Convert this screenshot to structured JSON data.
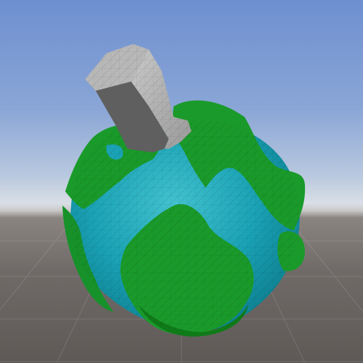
{
  "scene": {
    "background": {
      "sky_top_color": "#6e8fd0",
      "horizon_color": "#d9dee6",
      "ground_color": "#6f6a67"
    },
    "planet": {
      "ocean_color": "#1aa3b5",
      "land_color": "#1a9a2a",
      "land_dark_color": "#0f7a18",
      "wireframe_visible": true
    },
    "pillar": {
      "stone_color": "#a9a9a9",
      "shadow_color": "#5f5f5f"
    }
  }
}
